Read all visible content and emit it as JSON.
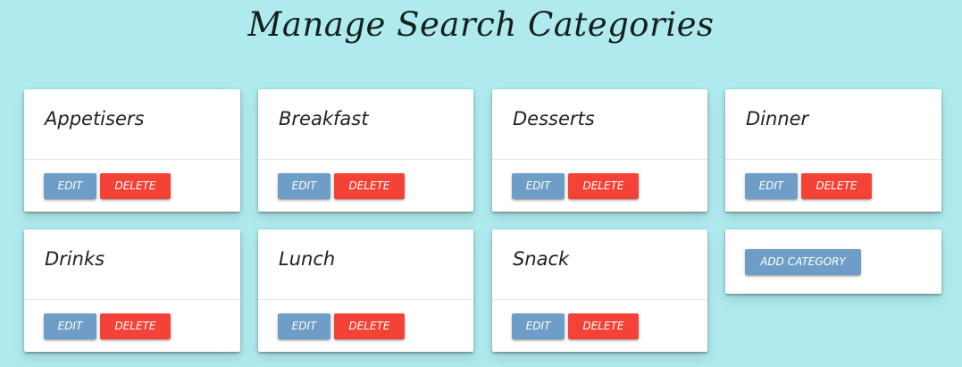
{
  "page": {
    "title": "Manage Search Categories"
  },
  "buttons": {
    "edit_label": "EDIT",
    "delete_label": "DELETE",
    "add_label": "ADD CATEGORY"
  },
  "categories": [
    {
      "name": "Appetisers"
    },
    {
      "name": "Breakfast"
    },
    {
      "name": "Desserts"
    },
    {
      "name": "Dinner"
    },
    {
      "name": "Drinks"
    },
    {
      "name": "Lunch"
    },
    {
      "name": "Snack"
    }
  ],
  "colors": {
    "background": "#afebee",
    "edit_button": "#6e9ec7",
    "delete_button": "#f44336",
    "add_button": "#6e9ec7",
    "card": "#ffffff"
  }
}
